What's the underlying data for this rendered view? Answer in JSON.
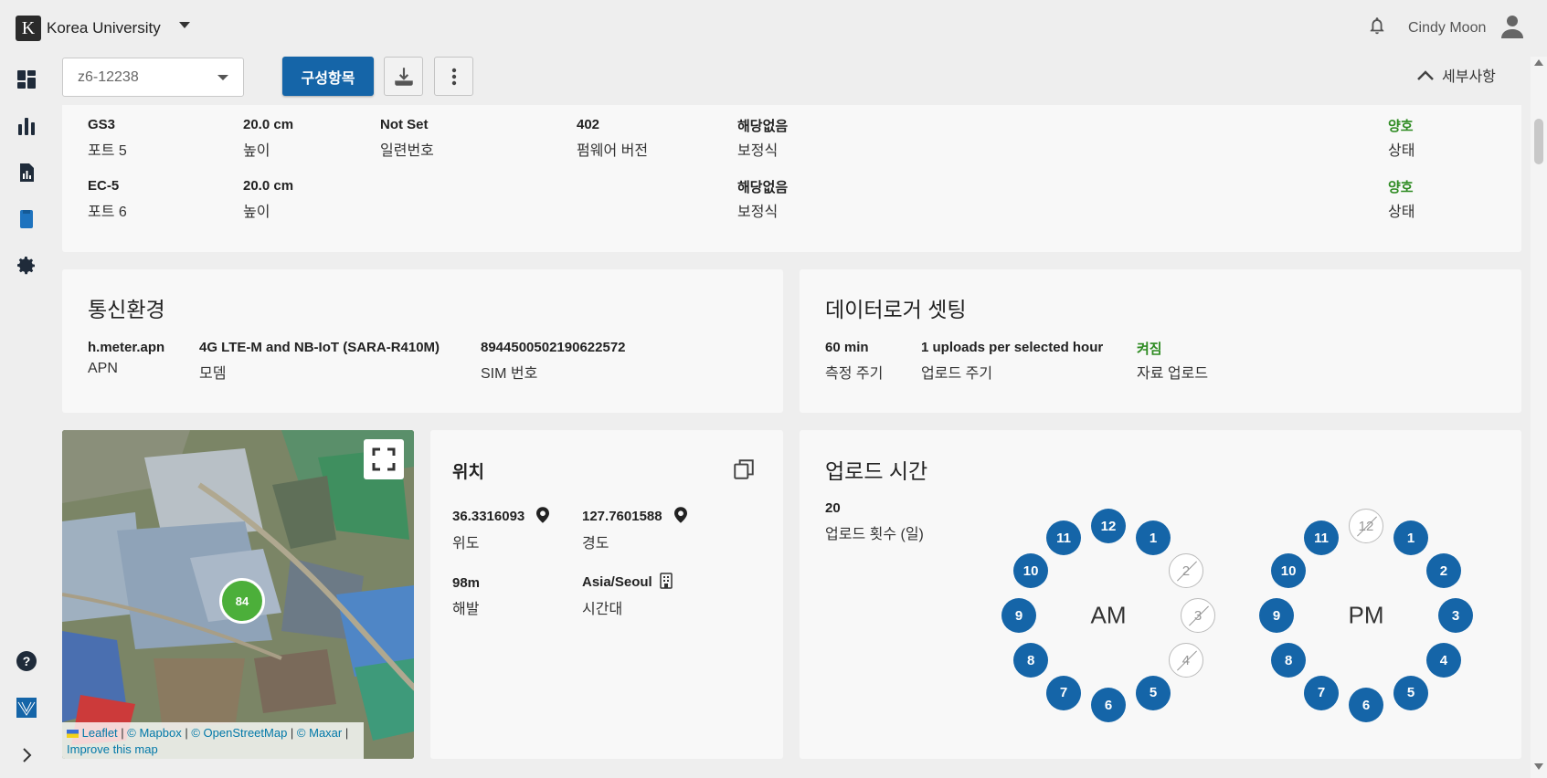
{
  "header": {
    "org_logo_letter": "K",
    "org_name": "Korea University",
    "user_name": "Cindy Moon"
  },
  "toolbar": {
    "device_select_value": "z6-12238",
    "config_button": "구성항목",
    "details_toggle": "세부사항"
  },
  "sensors": [
    {
      "name": "GS3",
      "port": "포트 5",
      "height": "20.0 cm",
      "height_label": "높이",
      "serial": "Not Set",
      "serial_label": "일련번호",
      "firmware": "402",
      "firmware_label": "펌웨어 버전",
      "calibration": "해당없음",
      "calibration_label": "보정식",
      "status": "양호",
      "status_label": "상태"
    },
    {
      "name": "EC-5",
      "port": "포트 6",
      "height": "20.0 cm",
      "height_label": "높이",
      "serial": "",
      "serial_label": "",
      "firmware": "",
      "firmware_label": "",
      "calibration": "해당없음",
      "calibration_label": "보정식",
      "status": "양호",
      "status_label": "상태"
    }
  ],
  "comm": {
    "title": "통신환경",
    "apn": "h.meter.apn",
    "apn_label": "APN",
    "modem": "4G LTE-M and NB-IoT (SARA-R410M)",
    "modem_label": "모뎀",
    "sim": "8944500502190622572",
    "sim_label": "SIM 번호"
  },
  "logger": {
    "title": "데이터로거 셋팅",
    "interval": "60 min",
    "interval_label": "측정 주기",
    "upload": "1 uploads per selected hour",
    "upload_label": "업로드 주기",
    "data_upload": "켜짐",
    "data_upload_label": "자료 업로드"
  },
  "map": {
    "cluster_count": "84",
    "attrib_leaflet": "Leaflet",
    "attrib_mapbox": "© Mapbox",
    "attrib_osm": "© OpenStreetMap",
    "attrib_maxar": "© Maxar",
    "improve": "Improve this map"
  },
  "location": {
    "title": "위치",
    "lat": "36.3316093",
    "lat_label": "위도",
    "lng": "127.7601588",
    "lng_label": "경도",
    "elev": "98m",
    "elev_label": "해발",
    "tz": "Asia/Seoul",
    "tz_label": "시간대"
  },
  "upload_time": {
    "title": "업로드 시간",
    "count": "20",
    "count_label": "업로드 횟수 (일)",
    "am_label": "AM",
    "pm_label": "PM",
    "am_active": [
      12,
      1,
      5,
      6,
      7,
      8,
      9,
      10,
      11
    ],
    "am_inactive": [
      2,
      3,
      4
    ],
    "pm_active": [
      1,
      2,
      3,
      4,
      5,
      6,
      7,
      8,
      9,
      10,
      11
    ],
    "pm_inactive": [
      12
    ]
  },
  "colors": {
    "primary": "#1565a8",
    "ok": "#2e8b22",
    "cluster": "#4caf3a"
  }
}
